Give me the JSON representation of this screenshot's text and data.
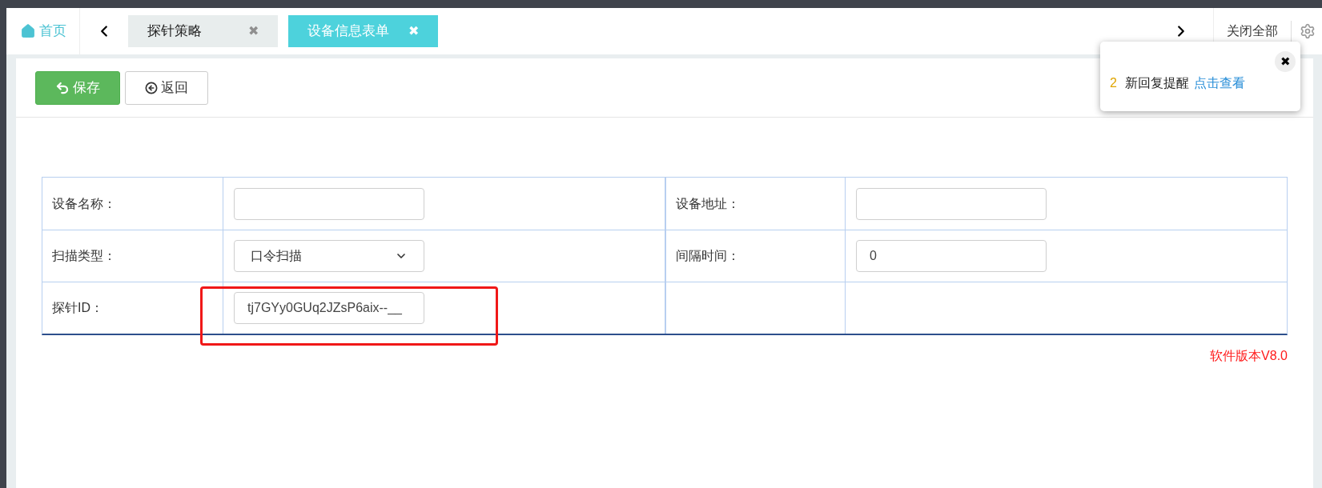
{
  "tab_bar": {
    "home": "首页",
    "tabs": [
      {
        "label": "探针策略",
        "close": "✖",
        "selected": false
      },
      {
        "label": "设备信息表单",
        "close": "✖",
        "selected": true
      }
    ],
    "close_all": "关闭全部"
  },
  "toolbar": {
    "buttons": [
      {
        "label": "保存",
        "kind": "primary"
      },
      {
        "label": "返回",
        "kind": "default"
      }
    ]
  },
  "form": {
    "rows": [
      {
        "cells": [
          {
            "label": "设备名称：",
            "field": {
              "kind": "text",
              "highlighted": false
            }
          },
          {
            "label": "设备地址：",
            "field": {
              "kind": "text",
              "highlighted": false
            }
          }
        ]
      },
      {
        "cells": [
          {
            "label": "扫描类型：",
            "field": {
              "kind": "select",
              "value": "口令扫描",
              "highlighted": false
            }
          },
          {
            "label": "间隔时间：",
            "field": {
              "kind": "text",
              "value": "0",
              "highlighted": false
            }
          }
        ]
      },
      {
        "cells": [
          {
            "label": "探针ID：",
            "field": {
              "kind": "text",
              "value": "tj7GYy0GUq2JZsP6aix--__",
              "highlighted": true
            }
          }
        ]
      }
    ]
  },
  "version": "软件版本V8.0",
  "notification": {
    "close": "✖",
    "count": "2",
    "text": "新回复提醒",
    "link": "点击查看"
  }
}
